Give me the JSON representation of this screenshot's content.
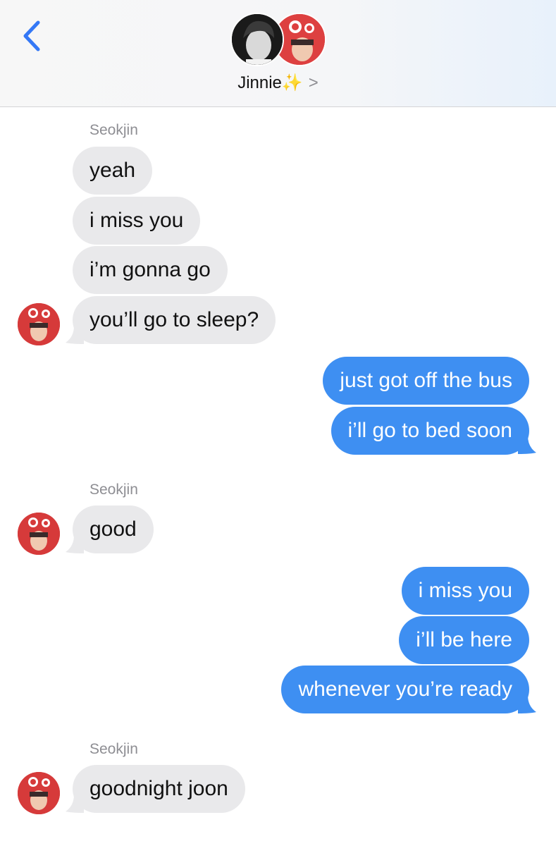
{
  "header": {
    "contact_name": "Jinnie✨",
    "chevron": ">",
    "back_icon": "chevron-left-icon",
    "accent_color": "#3478f6"
  },
  "messages": [
    {
      "sender": "Seokjin",
      "side": "incoming",
      "texts": [
        "yeah",
        "i miss you",
        "i’m gonna go",
        "you’ll go to sleep?"
      ]
    },
    {
      "side": "outgoing",
      "texts": [
        "just got off the bus",
        "i’ll go to bed soon"
      ]
    },
    {
      "sender": "Seokjin",
      "side": "incoming",
      "texts": [
        "good"
      ]
    },
    {
      "side": "outgoing",
      "texts": [
        "i miss you",
        "i’ll be here",
        "whenever you’re ready"
      ]
    },
    {
      "sender": "Seokjin",
      "side": "incoming",
      "texts": [
        "goodnight joon"
      ]
    }
  ],
  "colors": {
    "incoming_bubble": "#e9e9eb",
    "outgoing_bubble": "#3e8ff2",
    "sender_label": "#8e8e93"
  }
}
